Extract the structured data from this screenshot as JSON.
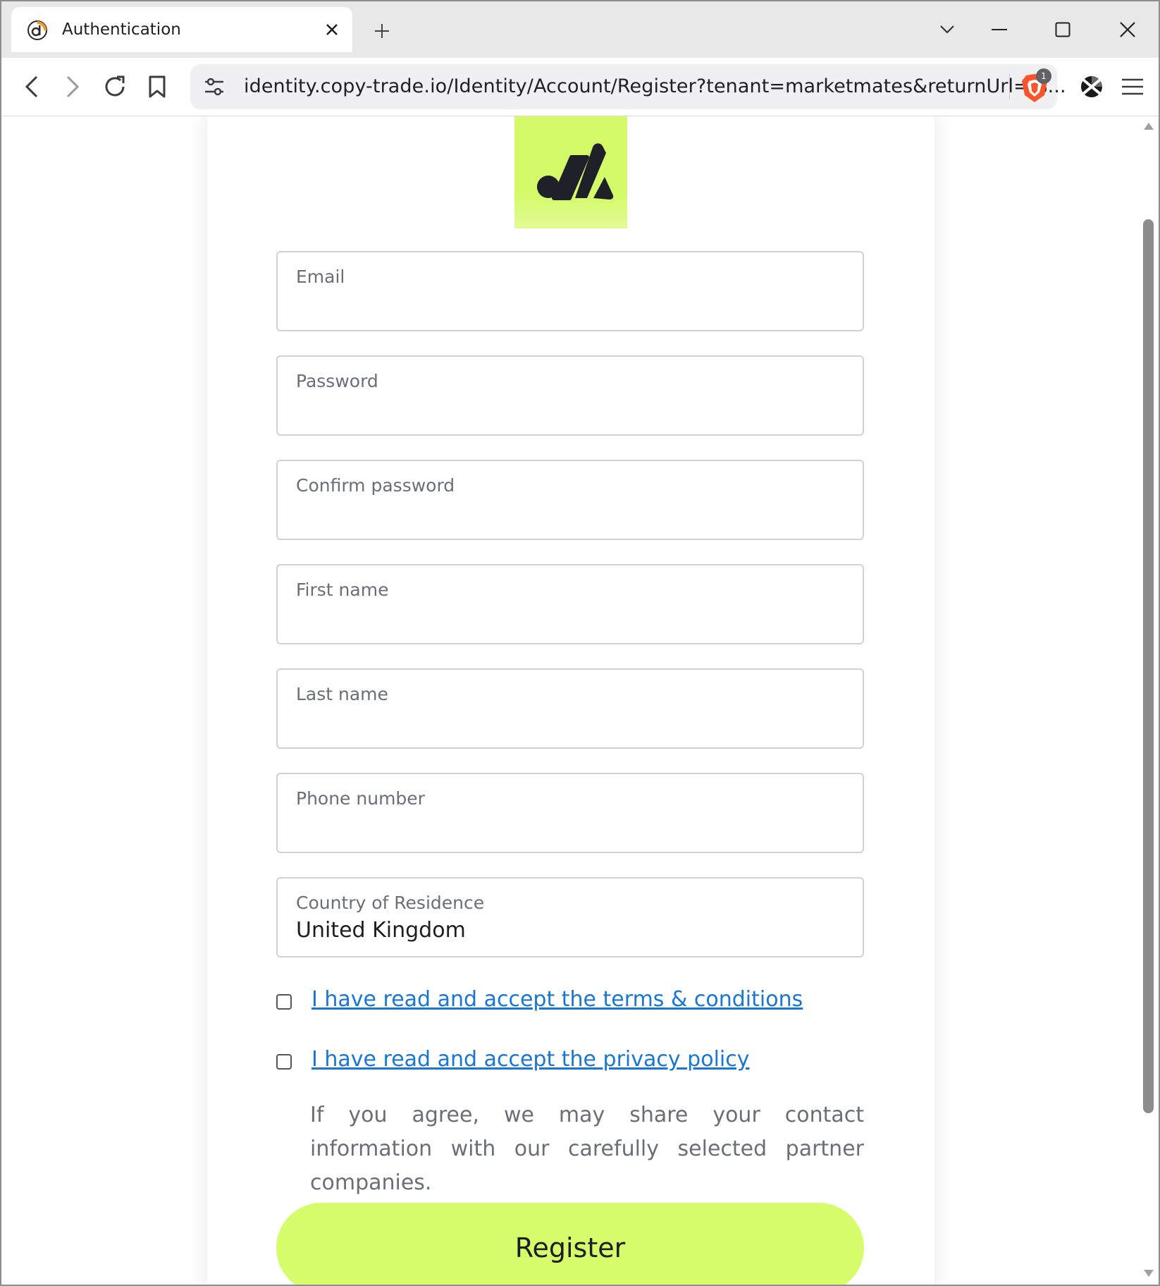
{
  "browser": {
    "tab": {
      "title": "Authentication"
    },
    "address_bar": {
      "url": "identity.copy-trade.io/Identity/Account/Register?tenant=marketmates&returnUrl=%..."
    },
    "shields": {
      "badge_count": "1"
    }
  },
  "form": {
    "fields": {
      "email": {
        "label": "Email"
      },
      "password": {
        "label": "Password"
      },
      "confirm_password": {
        "label": "Confirm password"
      },
      "first_name": {
        "label": "First name"
      },
      "last_name": {
        "label": "Last name"
      },
      "phone_number": {
        "label": "Phone number"
      },
      "country": {
        "label": "Country of Residence",
        "value": "United Kingdom"
      }
    },
    "terms": {
      "label": "I have read and accept the terms & conditions"
    },
    "privacy": {
      "label": "I have read and accept the privacy policy"
    },
    "privacy_note": "If you agree, we may share your contact information with our carefully selected partner companies.",
    "register_label": "Register"
  },
  "colors": {
    "brand_accent": "#d6fb6b",
    "link": "#1976d2",
    "logo_mark": "#1e2128"
  }
}
